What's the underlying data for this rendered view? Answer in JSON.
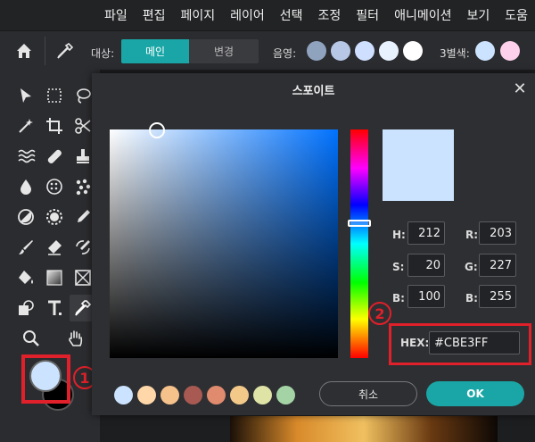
{
  "menubar": {
    "items": [
      "파일",
      "편집",
      "페이지",
      "레이어",
      "선택",
      "조정",
      "필터",
      "애니메이션",
      "보기",
      "도움"
    ]
  },
  "toolbar": {
    "target_label": "대상:",
    "target_main": "메인",
    "target_change": "변경",
    "shade_label": "음영:",
    "shade_colors": [
      "#8fa3bf",
      "#b6c8e6",
      "#cfdfff",
      "#e8f2ff",
      "#ffffff"
    ],
    "triad_label": "3별색:",
    "triad_colors": [
      "#cbe3ff",
      "#ffd0ec"
    ]
  },
  "dialog": {
    "title": "스포이트",
    "close": "✕",
    "fields": {
      "h_label": "H:",
      "h": "212",
      "s_label": "S:",
      "s": "20",
      "b_label": "B:",
      "b": "100",
      "r_label": "R:",
      "r": "203",
      "g_label": "G:",
      "g": "227",
      "bl_label": "B:",
      "bl": "255"
    },
    "hex_label": "HEX:",
    "hex_value": "#CBE3FF",
    "preview_color": "#cbe3ff",
    "swatches": [
      "#cbe3ff",
      "#ffd7a8",
      "#f6c28b",
      "#a85a52",
      "#e08a6e",
      "#f3c98a",
      "#dfe3a6",
      "#a4d4a6"
    ],
    "cancel_label": "취소",
    "ok_label": "OK"
  },
  "annotations": {
    "one": "1",
    "two": "2"
  },
  "colors": {
    "foreground": "#cbe3ff",
    "background": "#000000",
    "accent": "#1aa6a6",
    "highlight": "#e0202a"
  }
}
